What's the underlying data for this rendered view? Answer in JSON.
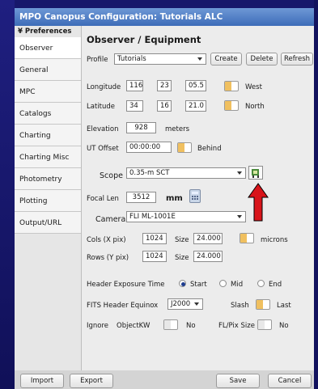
{
  "window": {
    "title": "MPO Canopus Configuration: Tutorials ALC"
  },
  "sidebar": {
    "header": "¥ Preferences",
    "items": [
      {
        "label": "Observer"
      },
      {
        "label": "General"
      },
      {
        "label": "MPC"
      },
      {
        "label": "Catalogs"
      },
      {
        "label": "Charting"
      },
      {
        "label": "Charting Misc"
      },
      {
        "label": "Photometry"
      },
      {
        "label": "Plotting"
      },
      {
        "label": "Output/URL"
      }
    ]
  },
  "main": {
    "heading": "Observer / Equipment",
    "profile": {
      "label": "Profile",
      "value": "Tutorials",
      "create": "Create",
      "delete": "Delete",
      "refresh": "Refresh"
    },
    "longitude": {
      "label": "Longitude",
      "d": "116",
      "m": "23",
      "s": "05.5",
      "west": "West"
    },
    "latitude": {
      "label": "Latitude",
      "d": "34",
      "m": "16",
      "s": "21.0",
      "north": "North"
    },
    "elevation": {
      "label": "Elevation",
      "value": "928",
      "unit": "meters"
    },
    "ut_offset": {
      "label": "UT Offset",
      "value": "00:00:00",
      "behind": "Behind"
    },
    "scope": {
      "label": "Scope",
      "value": "0.35-m SCT"
    },
    "focal": {
      "label": "Focal Len",
      "value": "3512",
      "unit": "mm"
    },
    "camera": {
      "label": "Camera",
      "value": "FLI ML-1001E"
    },
    "cols": {
      "label": "Cols (X pix)",
      "value": "1024",
      "size_label": "Size",
      "size": "24.000",
      "microns": "microns"
    },
    "rows": {
      "label": "Rows (Y pix)",
      "value": "1024",
      "size_label": "Size",
      "size": "24.000"
    },
    "header_exp": {
      "label": "Header Exposure Time",
      "start": "Start",
      "mid": "Mid",
      "end": "End"
    },
    "fits": {
      "label": "FITS Header Equinox",
      "value": "J2000",
      "slash": "Slash",
      "last": "Last"
    },
    "ignore": {
      "label": "Ignore",
      "objectkw": "ObjectKW",
      "no1": "No",
      "flpix": "FL/Pix Size",
      "no2": "No"
    }
  },
  "footer": {
    "import": "Import",
    "export": "Export",
    "save": "Save",
    "cancel": "Cancel"
  },
  "colors": {
    "title_bar": "#3d6cb8",
    "toggle": "#f0c060",
    "arrow": "#d8141a",
    "desktop": "#17176b"
  }
}
